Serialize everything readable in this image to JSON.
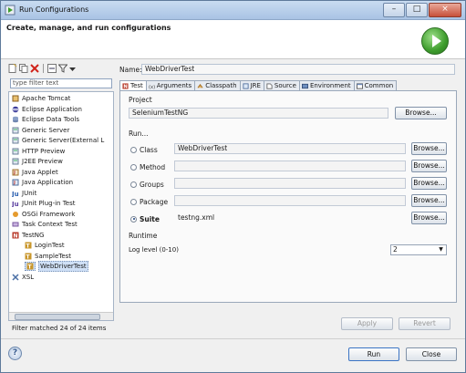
{
  "window": {
    "title": "Run Configurations",
    "controls": {
      "minimize": "–",
      "maximize": "□",
      "close": "×"
    }
  },
  "header": {
    "title": "Create, manage, and run configurations",
    "logo_icon": "run-icon"
  },
  "left": {
    "toolbar_icons": [
      "new-configuration-icon",
      "duplicate-icon",
      "delete-icon",
      "collapse-all-icon",
      "filter-icon",
      "dropdown-icon"
    ],
    "filter_placeholder": "type filter text",
    "tree": [
      {
        "label": "Apache Tomcat",
        "icon": "tomcat-icon",
        "level": 0
      },
      {
        "label": "Eclipse Application",
        "icon": "eclipse-icon",
        "level": 0
      },
      {
        "label": "Eclipse Data Tools",
        "icon": "data-tools-icon",
        "level": 0
      },
      {
        "label": "Generic Server",
        "icon": "server-icon",
        "level": 0
      },
      {
        "label": "Generic Server(External L",
        "icon": "server-icon",
        "level": 0
      },
      {
        "label": "HTTP Preview",
        "icon": "server-icon",
        "level": 0
      },
      {
        "label": "J2EE Preview",
        "icon": "server-icon",
        "level": 0
      },
      {
        "label": "Java Applet",
        "icon": "java-applet-icon",
        "level": 0
      },
      {
        "label": "Java Application",
        "icon": "java-application-icon",
        "level": 0
      },
      {
        "label": "JUnit",
        "icon": "junit-icon",
        "level": 0
      },
      {
        "label": "JUnit Plug-in Test",
        "icon": "junit-plugin-icon",
        "level": 0
      },
      {
        "label": "OSGi Framework",
        "icon": "osgi-icon",
        "level": 0
      },
      {
        "label": "Task Context Test",
        "icon": "task-context-icon",
        "level": 0
      },
      {
        "label": "TestNG",
        "icon": "testng-icon",
        "level": 0
      },
      {
        "label": "LoginTest",
        "icon": "testng-config-icon",
        "level": 1
      },
      {
        "label": "SampleTest",
        "icon": "testng-config-icon",
        "level": 1
      },
      {
        "label": "WebDriverTest",
        "icon": "testng-config-icon",
        "level": 1,
        "selected": true
      },
      {
        "label": "XSL",
        "icon": "xsl-icon",
        "level": 0
      }
    ],
    "filter_status": "Filter matched 24 of 24 items"
  },
  "right": {
    "name_label": "Name:",
    "name_value": "WebDriverTest",
    "tabs": [
      {
        "label": "Test",
        "icon": "testng-icon",
        "active": true
      },
      {
        "label": "Arguments",
        "icon": "arguments-icon"
      },
      {
        "label": "Classpath",
        "icon": "classpath-icon"
      },
      {
        "label": "JRE",
        "icon": "jre-icon"
      },
      {
        "label": "Source",
        "icon": "source-icon"
      },
      {
        "label": "Environment",
        "icon": "environment-icon"
      },
      {
        "label": "Common",
        "icon": "common-icon"
      }
    ],
    "project_label": "Project",
    "project_value": "SeleniumTestNG",
    "browse_label": "Browse...",
    "run_label": "Run...",
    "run_options": [
      {
        "label": "Class",
        "value": "WebDriverTest",
        "checked": false
      },
      {
        "label": "Method",
        "value": "",
        "checked": false
      },
      {
        "label": "Groups",
        "value": "",
        "checked": false
      },
      {
        "label": "Package",
        "value": "",
        "checked": false
      },
      {
        "label": "Suite",
        "value": "testng.xml",
        "checked": true
      }
    ],
    "runtime_label": "Runtime",
    "log_level_label": "Log level (0-10)",
    "log_level_value": "2",
    "apply_label": "Apply",
    "revert_label": "Revert"
  },
  "footer": {
    "help_icon": "help-icon",
    "help_glyph": "?",
    "run_label": "Run",
    "close_label": "Close"
  },
  "colors": {
    "accent": "#3d9c2c",
    "selection": "#cfe0f6",
    "titlebar": "#a9c3e4"
  }
}
